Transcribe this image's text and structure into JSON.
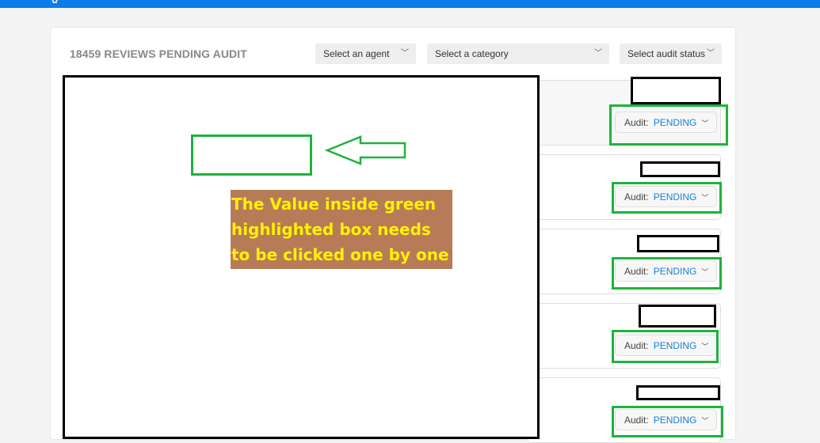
{
  "header": {
    "logo_text": "✿•"
  },
  "main": {
    "title": "18459 REVIEWS PENDING AUDIT",
    "filters": [
      {
        "label": "Select an agent"
      },
      {
        "label": "Select a category"
      },
      {
        "label": "Select audit status"
      }
    ],
    "reviews": [
      {
        "audit_label": "Audit:",
        "audit_value": "PENDING"
      },
      {
        "audit_label": "Audit:",
        "audit_value": "PENDING"
      },
      {
        "audit_label": "Audit:",
        "audit_value": "PENDING"
      },
      {
        "audit_label": "Audit:",
        "audit_value": "PENDING"
      },
      {
        "audit_label": "Audit:",
        "audit_value": "PENDING"
      }
    ]
  },
  "annotation": {
    "note": "The Value inside green highlighted box needs to be clicked one by one"
  },
  "colors": {
    "brand": "#0b7ce8",
    "highlight": "#1db33c",
    "pending": "#1a7fd6"
  }
}
